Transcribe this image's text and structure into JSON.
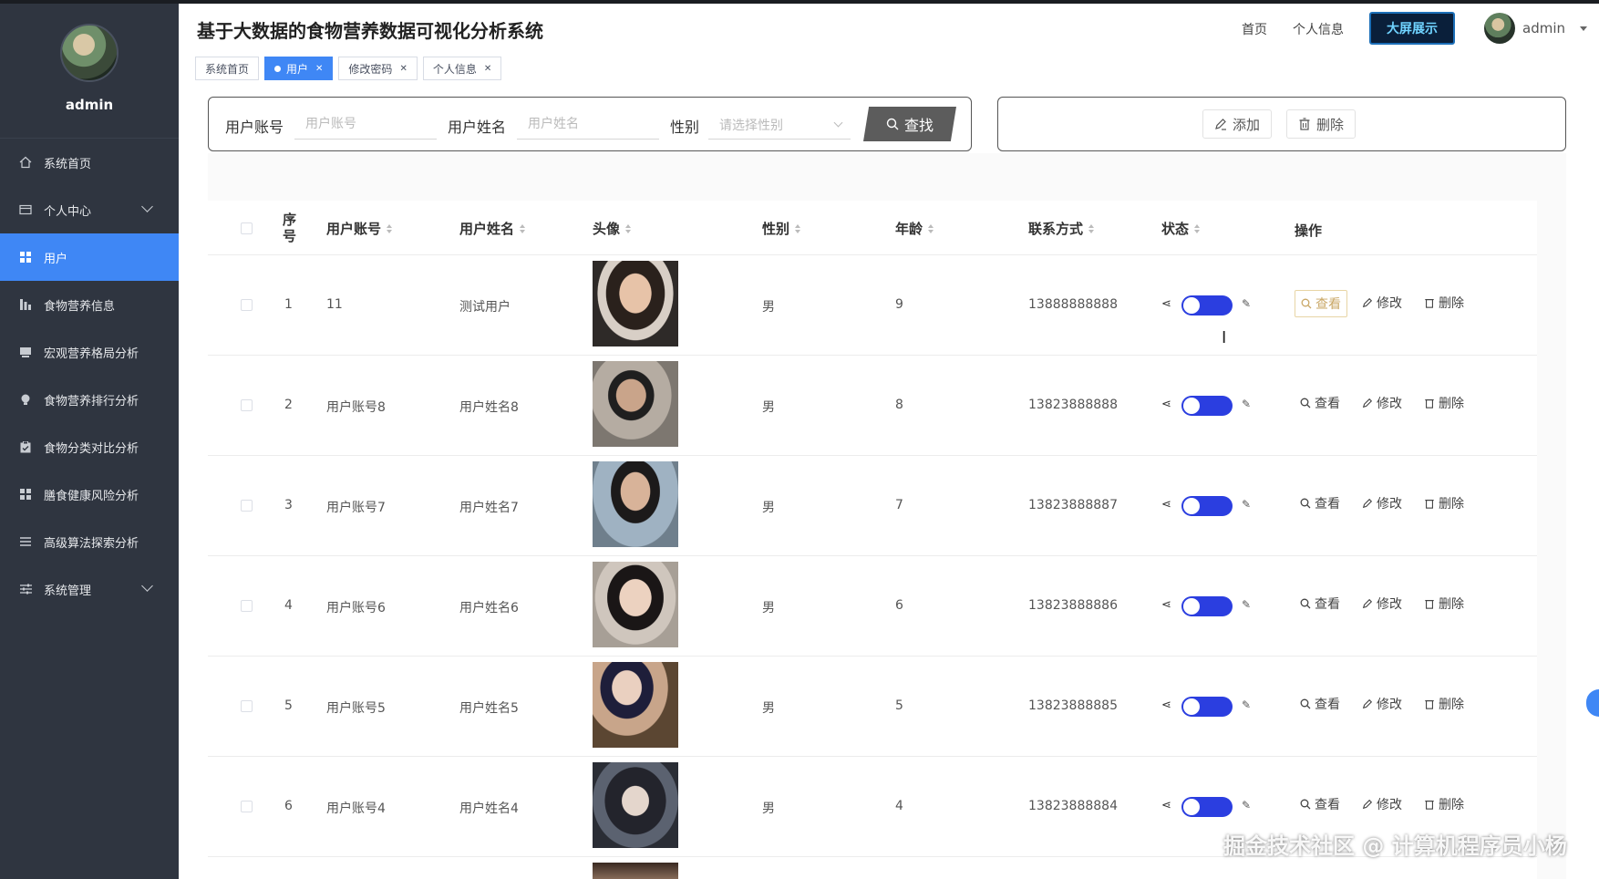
{
  "sidebar": {
    "username": "admin",
    "items": [
      {
        "label": "系统首页",
        "icon": "home-icon"
      },
      {
        "label": "个人中心",
        "icon": "card-icon"
      },
      {
        "label": "用户",
        "icon": "grid-icon"
      },
      {
        "label": "食物营养信息",
        "icon": "chart-icon"
      },
      {
        "label": "宏观营养格局分析",
        "icon": "book-icon"
      },
      {
        "label": "食物营养排行分析",
        "icon": "bulb-icon"
      },
      {
        "label": "食物分类对比分析",
        "icon": "clipboard-icon"
      },
      {
        "label": "膳食健康风险分析",
        "icon": "grid-icon"
      },
      {
        "label": "高级算法探索分析",
        "icon": "list-icon"
      },
      {
        "label": "系统管理",
        "icon": "sliders-icon"
      }
    ]
  },
  "header": {
    "title": "基于大数据的食物营养数据可视化分析系统",
    "nav_home": "首页",
    "nav_profile": "个人信息",
    "bigscreen": "大屏展示",
    "username": "admin"
  },
  "tabs": [
    {
      "label": "系统首页"
    },
    {
      "label": "用户"
    },
    {
      "label": "修改密码"
    },
    {
      "label": "个人信息"
    }
  ],
  "search": {
    "account_label": "用户账号",
    "account_placeholder": "用户账号",
    "name_label": "用户姓名",
    "name_placeholder": "用户姓名",
    "gender_label": "性别",
    "gender_placeholder": "请选择性别",
    "search_button": "查找"
  },
  "actions": {
    "add": "添加",
    "delete": "删除"
  },
  "table": {
    "columns": {
      "index": "序号",
      "account": "用户账号",
      "name": "用户姓名",
      "avatar": "头像",
      "gender": "性别",
      "age": "年龄",
      "contact": "联系方式",
      "status": "状态",
      "ops": "操作"
    },
    "ops": {
      "view": "查看",
      "edit": "修改",
      "delete": "删除"
    },
    "rows": [
      {
        "index": "1",
        "account": "11",
        "name": "测试用户",
        "gender": "男",
        "age": "9",
        "contact": "13888888888"
      },
      {
        "index": "2",
        "account": "用户账号8",
        "name": "用户姓名8",
        "gender": "男",
        "age": "8",
        "contact": "13823888888"
      },
      {
        "index": "3",
        "account": "用户账号7",
        "name": "用户姓名7",
        "gender": "男",
        "age": "7",
        "contact": "13823888887"
      },
      {
        "index": "4",
        "account": "用户账号6",
        "name": "用户姓名6",
        "gender": "男",
        "age": "6",
        "contact": "13823888886"
      },
      {
        "index": "5",
        "account": "用户账号5",
        "name": "用户姓名5",
        "gender": "男",
        "age": "5",
        "contact": "13823888885"
      },
      {
        "index": "6",
        "account": "用户账号4",
        "name": "用户姓名4",
        "gender": "男",
        "age": "4",
        "contact": "13823888884"
      }
    ]
  },
  "watermark": "掘金技术社区 @ 计算机程序员小杨"
}
